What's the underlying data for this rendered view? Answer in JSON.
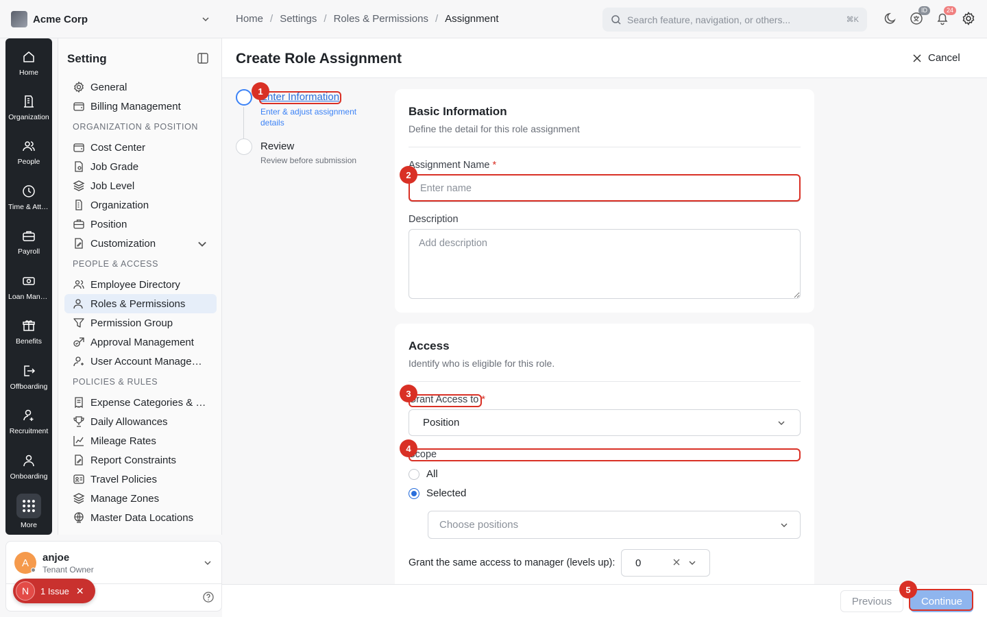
{
  "topbar": {
    "company": "Acme Corp",
    "breadcrumb": [
      "Home",
      "Settings",
      "Roles & Permissions",
      "Assignment"
    ],
    "search_placeholder": "Search feature, navigation, or others...",
    "search_shortcut": "⌘K",
    "id_badge": "ID",
    "notif_count": "24"
  },
  "rail": {
    "items": [
      {
        "label": "Home",
        "icon": "home-icon"
      },
      {
        "label": "Organization",
        "icon": "building-icon"
      },
      {
        "label": "People",
        "icon": "people-icon"
      },
      {
        "label": "Time & Attendance",
        "icon": "clock-icon"
      },
      {
        "label": "Payroll",
        "icon": "briefcase-icon"
      },
      {
        "label": "Loan Management",
        "icon": "cash-icon"
      },
      {
        "label": "Benefits",
        "icon": "gift-icon"
      },
      {
        "label": "Offboarding",
        "icon": "exit-icon"
      },
      {
        "label": "Recruitment",
        "icon": "user-add-icon"
      },
      {
        "label": "Onboarding",
        "icon": "user-icon"
      },
      {
        "label": "More",
        "icon": "grid-icon"
      }
    ]
  },
  "settings": {
    "title": "Setting",
    "items_top": [
      {
        "label": "General",
        "icon": "gear-icon"
      },
      {
        "label": "Billing Management",
        "icon": "wallet-icon"
      }
    ],
    "section_org": "ORGANIZATION & POSITION",
    "items_org": [
      {
        "label": "Cost Center",
        "icon": "wallet-icon"
      },
      {
        "label": "Job Grade",
        "icon": "document-badge-icon"
      },
      {
        "label": "Job Level",
        "icon": "layers-icon"
      },
      {
        "label": "Organization",
        "icon": "building-icon"
      },
      {
        "label": "Position",
        "icon": "briefcase-icon"
      },
      {
        "label": "Customization",
        "icon": "document-edit-icon"
      }
    ],
    "section_people": "PEOPLE & ACCESS",
    "items_people": [
      {
        "label": "Employee Directory",
        "icon": "people-icon"
      },
      {
        "label": "Roles & Permissions",
        "icon": "user-shield-icon"
      },
      {
        "label": "Permission Group",
        "icon": "filter-icon"
      },
      {
        "label": "Approval Management",
        "icon": "approval-icon"
      },
      {
        "label": "User Account Management",
        "icon": "user-icon"
      }
    ],
    "section_policies": "POLICIES & RULES",
    "items_policies": [
      {
        "label": "Expense Categories & Limits",
        "icon": "receipt-icon"
      },
      {
        "label": "Daily Allowances",
        "icon": "trophy-icon"
      },
      {
        "label": "Mileage Rates",
        "icon": "chart-icon"
      },
      {
        "label": "Report Constraints",
        "icon": "document-edit-icon"
      },
      {
        "label": "Travel Policies",
        "icon": "id-card-icon"
      },
      {
        "label": "Manage Zones",
        "icon": "layers-icon"
      },
      {
        "label": "Master Data Locations",
        "icon": "globe-icon"
      }
    ]
  },
  "user": {
    "initial": "A",
    "name": "anjoe",
    "role": "Tenant Owner"
  },
  "issue": {
    "letter": "N",
    "label": "1 Issue"
  },
  "main": {
    "title": "Create Role Assignment",
    "cancel": "Cancel",
    "steps": [
      {
        "title": "Enter Information",
        "sub": "Enter & adjust assignment details"
      },
      {
        "title": "Review",
        "sub": "Review before submission"
      }
    ],
    "basic": {
      "title": "Basic Information",
      "sub": "Define the detail for this role assignment",
      "name_label": "Assignment Name",
      "name_placeholder": "Enter name",
      "desc_label": "Description",
      "desc_placeholder": "Add description"
    },
    "access": {
      "title": "Access",
      "sub": "Identify who is eligible for this role.",
      "grant_label": "Grant Access to",
      "grant_value": "Position",
      "scope_label": "Scope",
      "scope_options": [
        "All",
        "Selected"
      ],
      "scope_selected": "Selected",
      "choose_placeholder": "Choose positions",
      "manager_label": "Grant the same access to manager (levels up):",
      "manager_value": "0"
    }
  },
  "footer": {
    "previous": "Previous",
    "continue": "Continue"
  },
  "annotations": [
    "1",
    "2",
    "3",
    "4",
    "5"
  ],
  "colors": {
    "accent": "#2a6fdb",
    "annotation": "#d93025",
    "rail_bg": "#1f2328",
    "continue_bg": "#8fb5ee"
  }
}
